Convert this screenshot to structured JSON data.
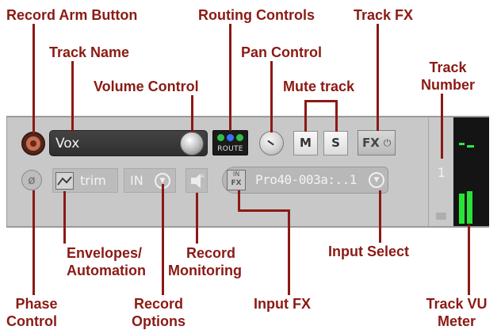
{
  "callouts": {
    "record_arm_button": "Record Arm Button",
    "track_name": "Track Name",
    "volume_control": "Volume Control",
    "routing_controls": "Routing Controls",
    "pan_control": "Pan Control",
    "mute_track": "Mute track",
    "track_fx": "Track FX",
    "track_number_1": "Track",
    "track_number_2": "Number",
    "envelopes_1": "Envelopes/",
    "envelopes_2": "Automation",
    "record_monitoring_1": "Record",
    "record_monitoring_2": "Monitoring",
    "input_select": "Input Select",
    "phase_control_1": "Phase",
    "phase_control_2": "Control",
    "record_options_1": "Record",
    "record_options_2": "Options",
    "input_fx": "Input FX",
    "track_vu_1": "Track VU",
    "track_vu_2": "Meter"
  },
  "track": {
    "name": "Vox",
    "number": "1",
    "route_label": "ROUTE",
    "mute_label": "M",
    "solo_label": "S",
    "fx_label": "FX",
    "fx_power_icon": "power-icon",
    "phase_symbol": "ø",
    "envelope_label": "trim",
    "record_input_label": "IN",
    "input_fx_top": "IN",
    "input_fx_bottom": "FX",
    "input_name": "Pro40-003a:..1"
  },
  "vu_meter": {
    "left_level": 0.3,
    "right_level": 0.32
  },
  "colors": {
    "callout": "#8b1a14",
    "panel_bg": "#c8c8c8",
    "name_field_bg": "#3a3a3a",
    "arm_button": "#c56f52",
    "route_dot_1": "#2fc04a",
    "route_dot_2": "#3b72ff",
    "route_dot_3": "#2fc04a",
    "vu_green": "#27e436",
    "vu_bg": "#141414"
  }
}
